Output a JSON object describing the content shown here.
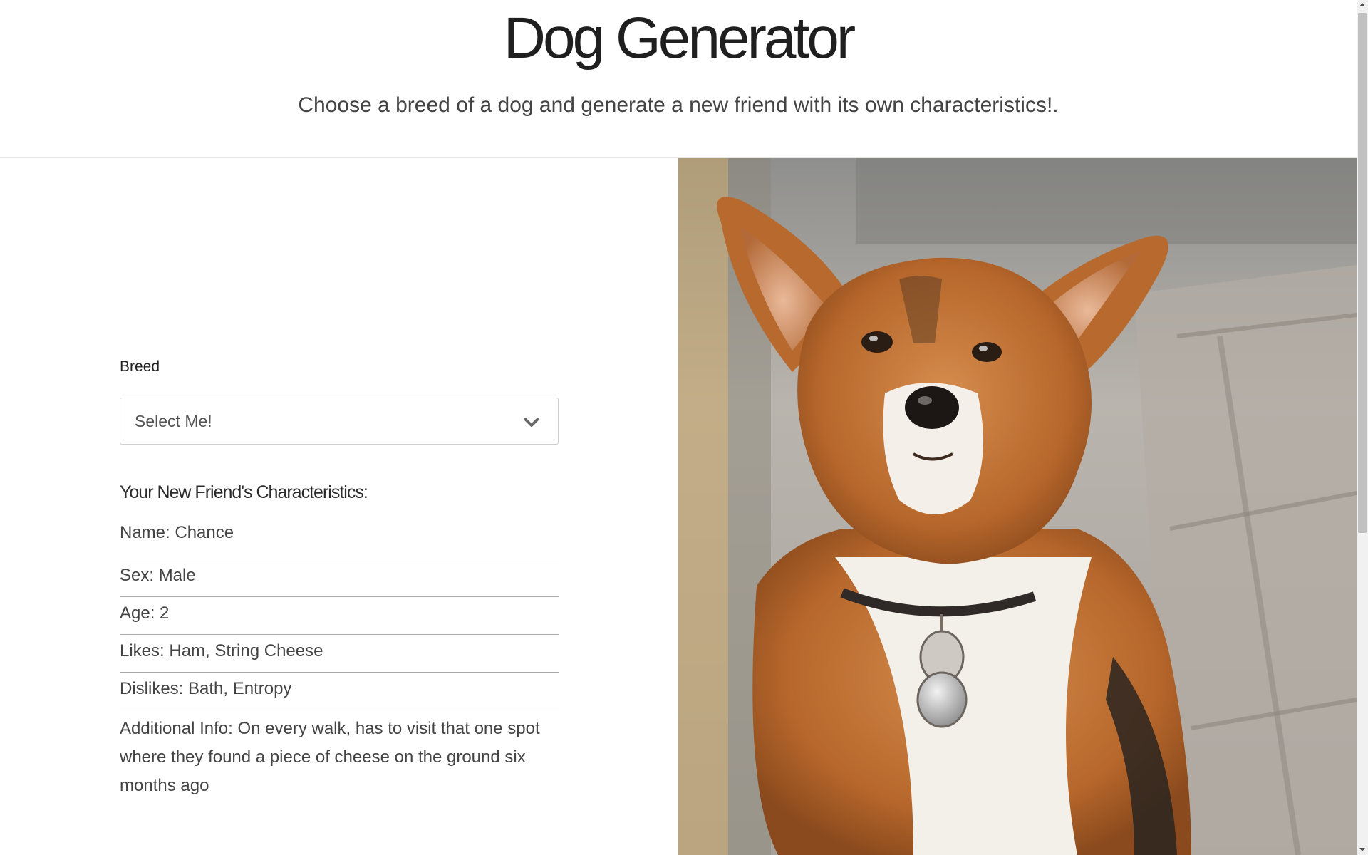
{
  "header": {
    "title": "Dog Generator",
    "subtitle": "Choose a breed of a dog and generate a new friend with its own characteristics!."
  },
  "form": {
    "breed_label": "Breed",
    "breed_select": {
      "selected": "Select Me!",
      "icon": "chevron-down-icon"
    }
  },
  "characteristics": {
    "heading": "Your New Friend's Characteristics:",
    "items": [
      "Name: Chance",
      "Sex: Male",
      "Age: 2",
      "Likes: Ham, String Cheese",
      "Dislikes: Bath, Entropy",
      "Additional Info: On every walk, has to visit that one spot where they found a piece of cheese on the ground six months ago"
    ]
  }
}
